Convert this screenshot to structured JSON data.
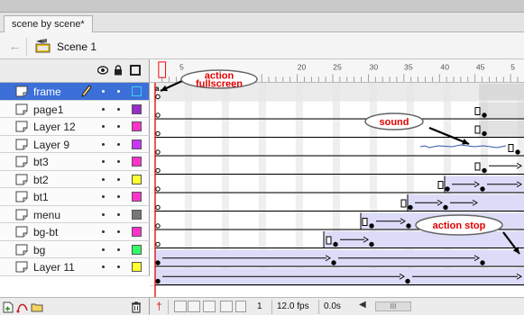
{
  "document": {
    "tab_label": "scene by scene*"
  },
  "nav": {
    "scene_label": "Scene 1"
  },
  "layers": [
    {
      "name": "frame",
      "selected": true,
      "color": "#3fd0f0"
    },
    {
      "name": "page1",
      "selected": false,
      "color": "#9a2cc8"
    },
    {
      "name": "Layer 12",
      "selected": false,
      "color": "#ff33cc"
    },
    {
      "name": "Layer 9",
      "selected": false,
      "color": "#cc33ff"
    },
    {
      "name": "bt3",
      "selected": false,
      "color": "#ff33cc"
    },
    {
      "name": "bt2",
      "selected": false,
      "color": "#ffff33"
    },
    {
      "name": "bt1",
      "selected": false,
      "color": "#ff33cc"
    },
    {
      "name": "menu",
      "selected": false,
      "color": "#777777"
    },
    {
      "name": "bg-bt",
      "selected": false,
      "color": "#ff33cc"
    },
    {
      "name": "bg",
      "selected": false,
      "color": "#33ff66"
    },
    {
      "name": "Layer 11",
      "selected": false,
      "color": "#ffff33"
    }
  ],
  "ruler": {
    "ticks": [
      "5",
      "20",
      "25",
      "30",
      "35",
      "40",
      "45",
      "5"
    ]
  },
  "callouts": [
    {
      "lines": [
        "action",
        "fullscreen"
      ]
    },
    {
      "lines": [
        "sound"
      ]
    },
    {
      "lines": [
        "action stop"
      ]
    }
  ],
  "footer": {
    "current_frame": "1",
    "fps": "12.0 fps",
    "time": "0.0s",
    "scroll_grip": "III"
  },
  "icons": {
    "eye": "eye-icon",
    "lock": "lock-icon",
    "outline": "outline-icon",
    "layer": "layer-icon",
    "pencil": "pencil-icon",
    "trash": "trash-icon",
    "new_layer": "new-layer-icon",
    "motion_guide": "motion-guide-icon",
    "new_folder": "new-folder-icon"
  }
}
